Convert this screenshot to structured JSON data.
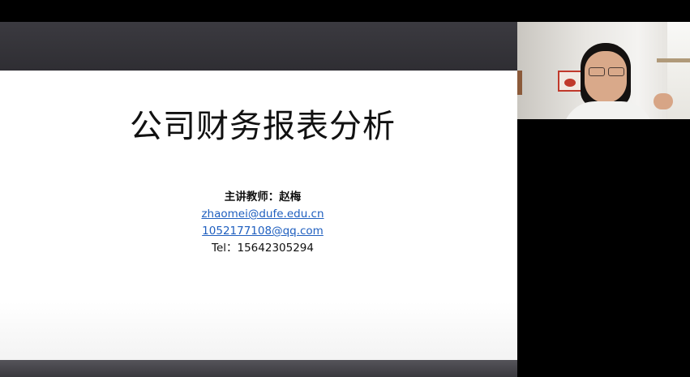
{
  "slide": {
    "title": "公司财务报表分析",
    "teacher": "主讲教师：赵梅",
    "email_1": "zhaomei@dufe.edu.cn",
    "email_2": "1052177108@qq.com",
    "tel": "Tel：15642305294"
  },
  "colors": {
    "link": "#1f5fbf",
    "top_bar": "#36353a",
    "background": "#000000"
  },
  "icons": [
    "webcam-video-feed"
  ]
}
